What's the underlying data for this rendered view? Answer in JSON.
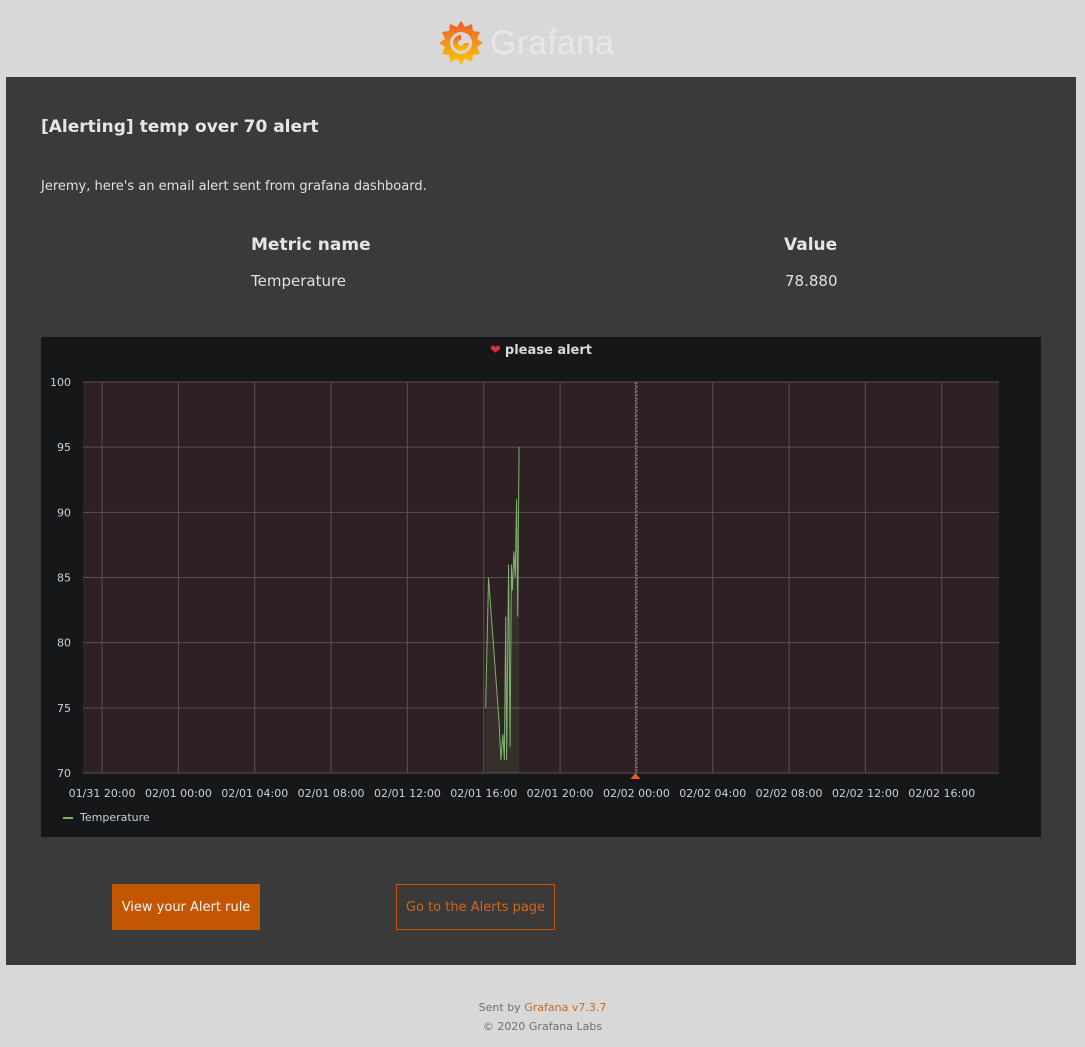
{
  "header": {
    "logo_icon": "grafana-logo-icon",
    "brand": "Grafana"
  },
  "email": {
    "title": "[Alerting] temp over 70 alert",
    "message": "Jeremy, here's an email alert sent from grafana dashboard.",
    "table": {
      "headers": [
        "Metric name",
        "Value"
      ],
      "rows": [
        [
          "Temperature",
          "78.880"
        ]
      ]
    }
  },
  "panel": {
    "title": "please alert",
    "status_icon": "broken-heart-icon",
    "status_color": "#e02f44"
  },
  "chart_data": {
    "type": "line",
    "title": "please alert",
    "xlabel": "",
    "ylabel": "",
    "ylim": [
      70,
      100
    ],
    "yticks": [
      70,
      75,
      80,
      85,
      90,
      95,
      100
    ],
    "xticks": [
      "01/31 20:00",
      "02/01 00:00",
      "02/01 04:00",
      "02/01 08:00",
      "02/01 12:00",
      "02/01 16:00",
      "02/01 20:00",
      "02/02 00:00",
      "02/02 04:00",
      "02/02 08:00",
      "02/02 12:00",
      "02/02 16:00"
    ],
    "xtick_hours": [
      0,
      4,
      8,
      12,
      16,
      20,
      24,
      28,
      32,
      36,
      40,
      44
    ],
    "xlim_hours": [
      -1,
      47
    ],
    "grid": true,
    "legend": "bottom-left",
    "series": [
      {
        "name": "Temperature",
        "color": "#7eb26d",
        "x_hours": [
          20.1,
          20.25,
          20.6,
          20.8,
          20.9,
          21.0,
          21.08,
          21.15,
          21.2,
          21.3,
          21.38,
          21.45,
          21.5,
          21.58,
          21.65,
          21.72,
          21.78,
          21.85
        ],
        "values": [
          75,
          85,
          78,
          74,
          71,
          73,
          71,
          82,
          71,
          86,
          72,
          86,
          84,
          87,
          85,
          91,
          82,
          95
        ]
      }
    ],
    "alert_threshold": 70,
    "threshold_fill": "#2e2124",
    "alert_event_hours": 27.95,
    "alert_color": "#ed5a1f"
  },
  "buttons": {
    "view_rule": "View your Alert rule",
    "alerts_page": "Go to the Alerts page"
  },
  "footer": {
    "sent_by": "Sent by",
    "version_link": "Grafana v7.3.7",
    "copyright": "© 2020 Grafana Labs"
  }
}
